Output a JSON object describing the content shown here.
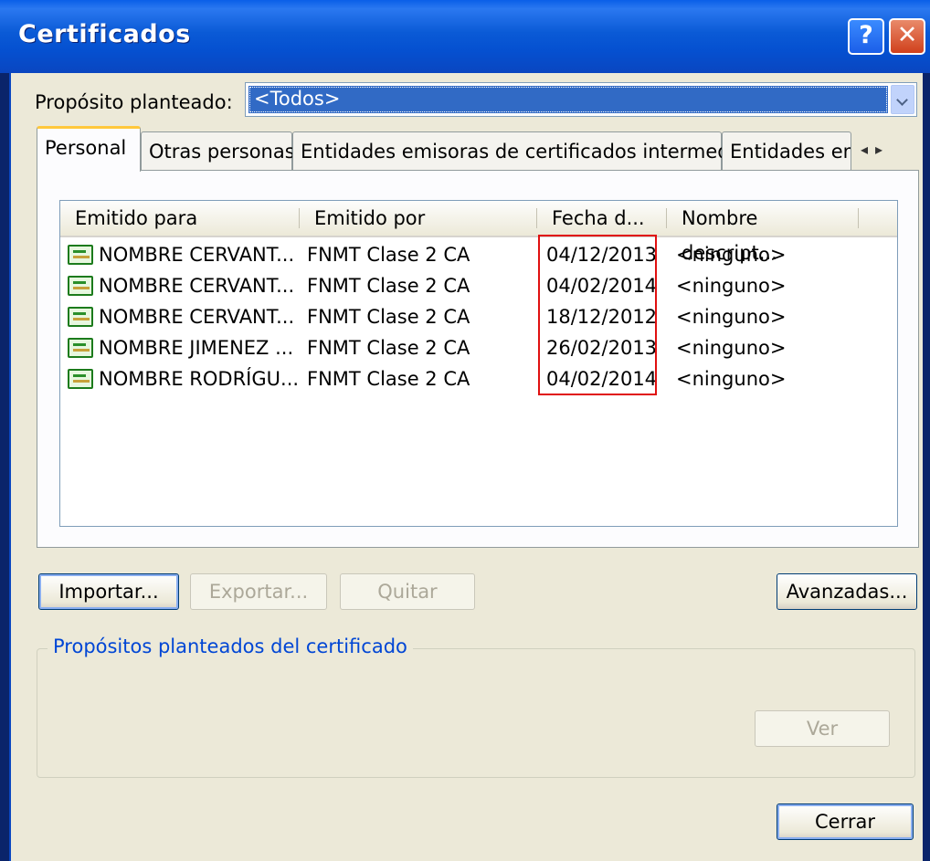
{
  "window": {
    "title": "Certificados",
    "help_label": "?",
    "close_label": "✕"
  },
  "purpose": {
    "label": "Propósito planteado:",
    "selected": "<Todos>"
  },
  "tabs": [
    {
      "label": "Personal",
      "active": true
    },
    {
      "label": "Otras personas",
      "active": false
    },
    {
      "label": "Entidades emisoras de certificados intermedias",
      "active": false
    },
    {
      "label": "Entidades emi",
      "active": false
    }
  ],
  "tab_scroll": {
    "left": "◂",
    "right": "▸"
  },
  "list": {
    "columns": [
      "Emitido para",
      "Emitido por",
      "Fecha d...",
      "Nombre descript..."
    ],
    "rows": [
      {
        "issued_to": "NOMBRE CERVANT...",
        "issued_by": "FNMT Clase 2 CA",
        "date": "04/12/2013",
        "friendly_name": "<ninguno>"
      },
      {
        "issued_to": "NOMBRE CERVANT...",
        "issued_by": "FNMT Clase 2 CA",
        "date": "04/02/2014",
        "friendly_name": "<ninguno>"
      },
      {
        "issued_to": "NOMBRE CERVANT...",
        "issued_by": "FNMT Clase 2 CA",
        "date": "18/12/2012",
        "friendly_name": "<ninguno>"
      },
      {
        "issued_to": "NOMBRE JIMENEZ ...",
        "issued_by": "FNMT Clase 2 CA",
        "date": "26/02/2013",
        "friendly_name": "<ninguno>"
      },
      {
        "issued_to": "NOMBRE RODRÍGU...",
        "issued_by": "FNMT Clase 2 CA",
        "date": "04/02/2014",
        "friendly_name": "<ninguno>"
      }
    ]
  },
  "buttons": {
    "import": "Importar...",
    "export": "Exportar...",
    "remove": "Quitar",
    "advanced": "Avanzadas...",
    "view": "Ver",
    "close": "Cerrar"
  },
  "group": {
    "title": "Propósitos planteados del certificado"
  },
  "colors": {
    "titlebar": "#0a5ad6",
    "dialog_bg": "#ece9d8",
    "selection": "#316ac5",
    "highlight_box": "#e01010",
    "group_title": "#0046d5"
  }
}
